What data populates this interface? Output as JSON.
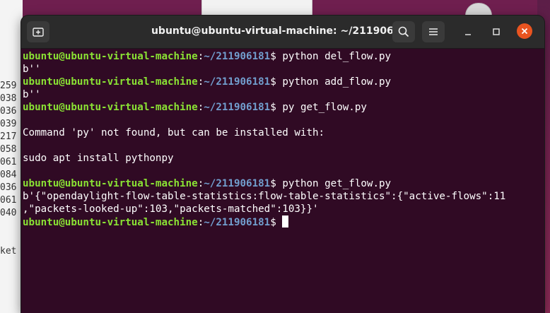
{
  "background": {
    "left_window_lines": [
      "259",
      "038",
      "036",
      "039",
      "217",
      "058",
      "061",
      "084",
      "036",
      "061",
      "040",
      "",
      "",
      "ket"
    ]
  },
  "terminal": {
    "title": "ubuntu@ubuntu-virtual-machine: ~/211906181",
    "prompt_user": "ubuntu@ubuntu-virtual-machine",
    "prompt_sep": ":",
    "prompt_path": "~/211906181",
    "prompt_end": "$ ",
    "lines": [
      {
        "type": "prompt",
        "cmd": "python del_flow.py"
      },
      {
        "type": "out",
        "text": "b''"
      },
      {
        "type": "prompt",
        "cmd": "python add_flow.py"
      },
      {
        "type": "out",
        "text": "b''"
      },
      {
        "type": "prompt",
        "cmd": "py get_flow.py"
      },
      {
        "type": "out",
        "text": ""
      },
      {
        "type": "out",
        "text": "Command 'py' not found, but can be installed with:"
      },
      {
        "type": "out",
        "text": ""
      },
      {
        "type": "out",
        "text": "sudo apt install pythonpy"
      },
      {
        "type": "out",
        "text": ""
      },
      {
        "type": "prompt",
        "cmd": "python get_flow.py"
      },
      {
        "type": "out",
        "text": "b'{\"opendaylight-flow-table-statistics:flow-table-statistics\":{\"active-flows\":11"
      },
      {
        "type": "out",
        "text": ",\"packets-looked-up\":103,\"packets-matched\":103}}'"
      },
      {
        "type": "prompt",
        "cmd": ""
      }
    ]
  },
  "colors": {
    "terminal_bg": "#300a24",
    "user": "#8ae234",
    "path": "#729fcf",
    "close": "#e95420"
  }
}
